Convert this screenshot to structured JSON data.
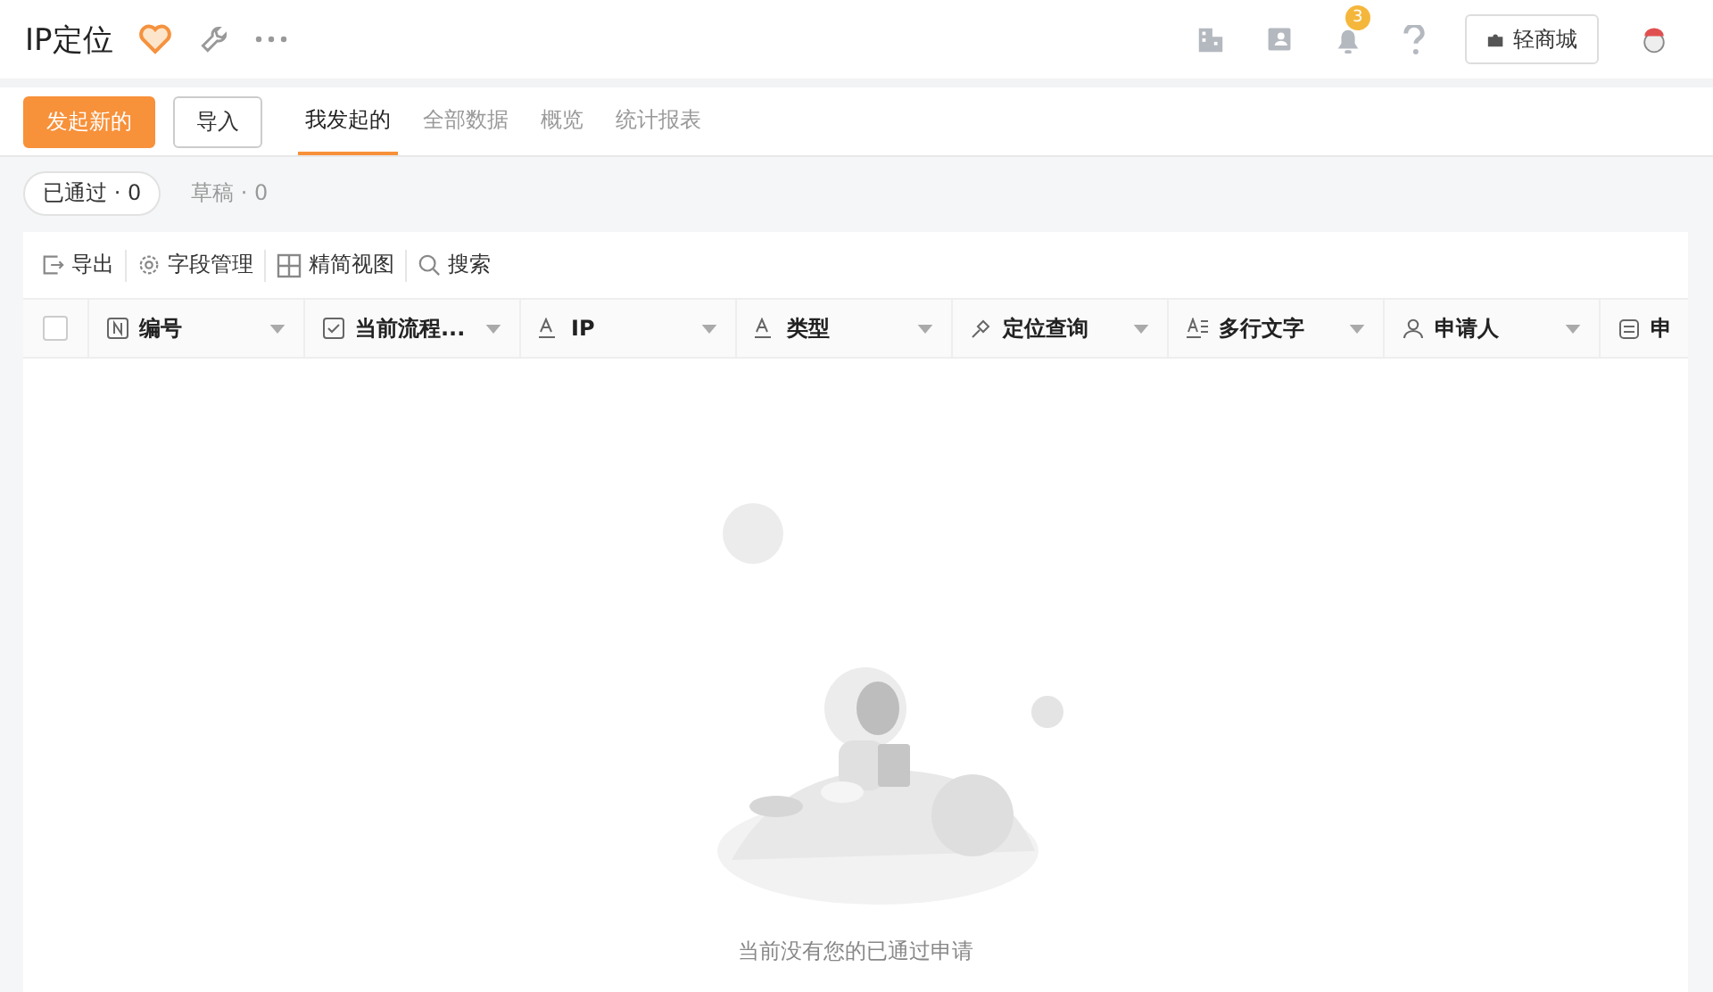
{
  "header": {
    "title": "IP定位",
    "favorite": true,
    "notification_count": "3",
    "store_button": "轻商城"
  },
  "actions": [
    {
      "label": "发起新的",
      "kind": "primary"
    },
    {
      "label": "导入",
      "kind": "default"
    }
  ],
  "tabs": [
    {
      "label": "我发起的",
      "selected": true
    },
    {
      "label": "全部数据",
      "selected": false
    },
    {
      "label": "概览",
      "selected": false
    },
    {
      "label": "统计报表",
      "selected": false
    }
  ],
  "filters": [
    {
      "label": "已通过 · 0",
      "selected": true
    },
    {
      "label": "草稿 · 0",
      "selected": false
    }
  ],
  "toolbar": [
    {
      "label": "导出",
      "kind": "export"
    },
    {
      "label": "字段管理",
      "kind": "settings"
    },
    {
      "label": "精简视图",
      "kind": "grid"
    },
    {
      "label": "搜索",
      "kind": "search"
    }
  ],
  "table": {
    "all_checked": false,
    "columns": [
      {
        "label": "编号",
        "kind": "number"
      },
      {
        "label": "当前流程...",
        "kind": "check"
      },
      {
        "label": "IP",
        "kind": "text"
      },
      {
        "label": "类型",
        "kind": "text"
      },
      {
        "label": "定位查询",
        "kind": "location"
      },
      {
        "label": "多行文字",
        "kind": "multiline"
      },
      {
        "label": "申请人",
        "kind": "person"
      },
      {
        "label": "申",
        "kind": "date"
      }
    ],
    "empty_message": "当前没有您的已通过申请"
  }
}
